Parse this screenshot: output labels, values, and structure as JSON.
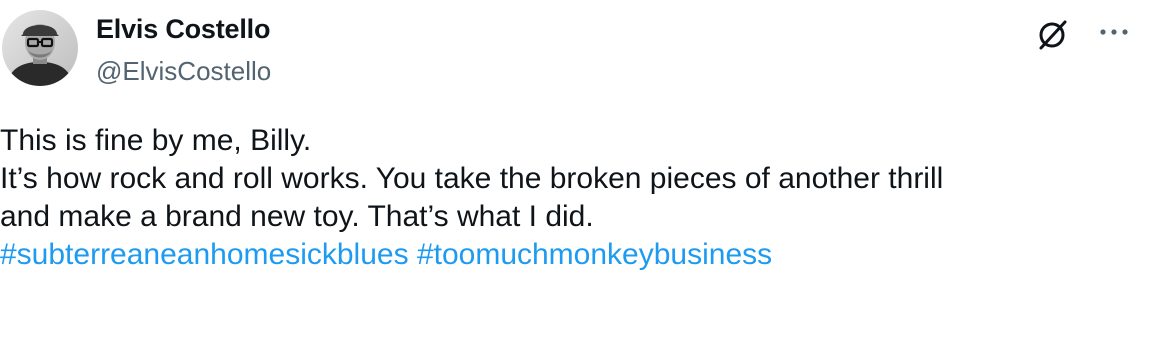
{
  "author": {
    "display_name": "Elvis Costello",
    "handle": "@ElvisCostello"
  },
  "header_actions": {
    "grok_icon": "grok-slash-circle-icon",
    "more_icon": "ellipsis-icon"
  },
  "tweet": {
    "line1": "This is fine by me, Billy.",
    "line2": "It’s how rock and roll works. You take the broken pieces of another thrill",
    "line3": "and make a brand new toy. That’s what I did.",
    "hashtags": [
      "#subterreaneanhomesickblues",
      "#toomuchmonkeybusiness"
    ]
  },
  "colors": {
    "text": "#0f1419",
    "secondary_text": "#536471",
    "hashtag": "#1d9bf0"
  }
}
